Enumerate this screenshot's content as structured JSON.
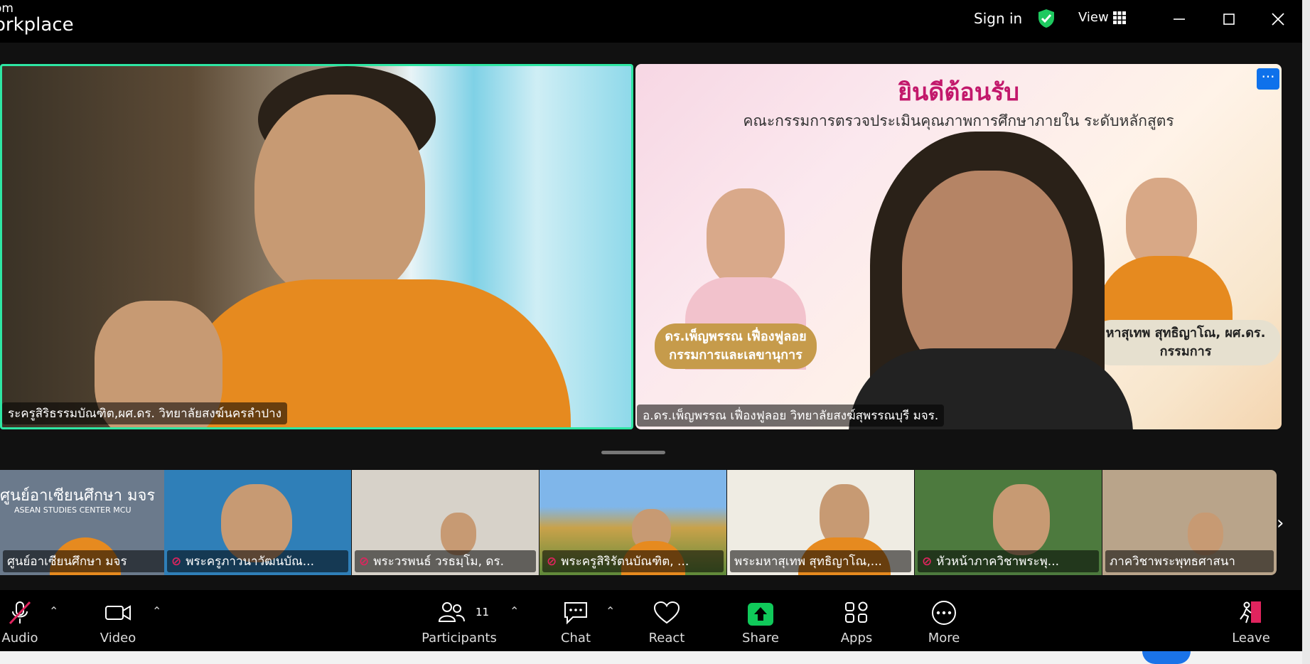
{
  "titlebar": {
    "brand_line1": "om",
    "brand_line2": "orkplace",
    "sign_in": "Sign in",
    "view_label": "View"
  },
  "tiles": [
    {
      "name": "ระครูสิริธรรมบัณฑิต,ผศ.ดร. วิทยาลัยสงฆ์นครลำปาง",
      "active_speaker": true
    },
    {
      "name": "อ.ดร.เพ็ญพรรณ เฟื่องฟูลอย วิทยาลัยสงฆ์สุพรรณบุรี มจร."
    }
  ],
  "slide": {
    "title": "ยินดีต้อนรับ",
    "subtitle": "คณะกรรมการตรวจประเมินคุณภาพการศึกษาภายใน ระดับหลักสูตร",
    "badge1_line1": "ดร.เพ็ญพรรณ เฟื่องฟูลอย",
    "badge1_line2": "กรรมการและเลขานุการ",
    "badge2_line1": "หาสุเทพ สุทธิญาโณ, ผศ.ดร.",
    "badge2_line2": "กรรมการ"
  },
  "more_button": "···",
  "thumbnails": [
    {
      "name": "ศูนย์อาเซียนศึกษา มจร",
      "muted": false,
      "bg": "#6b7a8c"
    },
    {
      "name": "พระครูภาวนาวัฒนบัณ...",
      "muted": true,
      "bg": "#2f7fb8"
    },
    {
      "name": "พระวรพนธ์ วรธมฺโม, ดร.",
      "muted": true,
      "bg": "#d7d2c9"
    },
    {
      "name": "พระครูสิริรัตนบัณฑิต, ...",
      "muted": true,
      "bg": "#5e9ad6"
    },
    {
      "name": "พระมหาสุเทพ สุทธิญาโณ,...",
      "muted": false,
      "bg": "#efece3"
    },
    {
      "name": "หัวหน้าภาควิชาพระพุ...",
      "muted": true,
      "bg": "#4d7a3e"
    },
    {
      "name": "ภาควิชาพระพุทธศาสนา",
      "muted": false,
      "bg": "#b9a48a"
    }
  ],
  "thumb_banner": {
    "line1": "ศูนย์อาเซียนศึกษา มจร",
    "line2": "ASEAN STUDIES CENTER MCU"
  },
  "toolbar": {
    "audio": "Audio",
    "video": "Video",
    "participants": "Participants",
    "participants_count": "11",
    "chat": "Chat",
    "react": "React",
    "share": "Share",
    "apps": "Apps",
    "more": "More",
    "leave": "Leave"
  },
  "colors": {
    "active_border": "#2ee6a3",
    "share_green": "#10c95a",
    "muted_red": "#e0245e",
    "accent_blue": "#0e71eb"
  },
  "icons": [
    "shield-check-icon",
    "grid-icon",
    "minimize-icon",
    "maximize-icon",
    "close-icon",
    "mic-muted-icon",
    "camera-icon",
    "participants-icon",
    "chat-icon",
    "heart-icon",
    "share-arrow-icon",
    "apps-icon",
    "more-dots-icon",
    "leave-icon",
    "chevron-right-icon"
  ]
}
